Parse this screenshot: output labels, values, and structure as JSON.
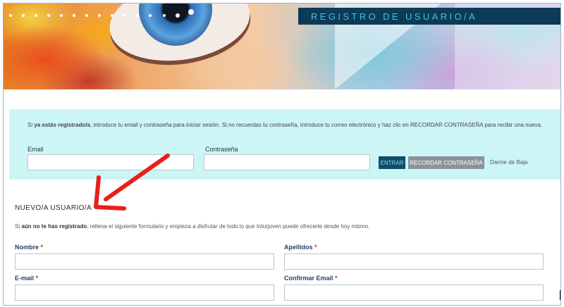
{
  "hero": {
    "title": "REGISTRO DE USUARIO/A",
    "dots_count": 12
  },
  "login": {
    "intro_pre": "Si ",
    "intro_bold": "ya estás registrado/a",
    "intro_post": ", introduce tu email y contraseña para iniciar sesión. Si no recuerdas tu contraseña, introduce tu correo electrónico y haz clic en RECORDAR CONTRASEÑA para recibir una nueva.",
    "email_label": "Email",
    "email_value": "",
    "password_label": "Contraseña",
    "password_value": "",
    "enter_button": "ENTRAR",
    "remember_button": "RECORDAR CONTRASEÑA",
    "unsubscribe_link": "Darme de Baja"
  },
  "register": {
    "title": "NUEVO/A USUARIO/A",
    "intro_pre": "Si ",
    "intro_bold": "aún no te has registrado",
    "intro_post": ", rellena el siguiente formulario y empieza a disfrutar de todo lo que Inturjoven puede ofrecerte desde hoy mismo.",
    "required_mark": "*",
    "fields": {
      "nombre": {
        "label": "Nombre",
        "value": ""
      },
      "apellidos": {
        "label": "Apellidos",
        "value": ""
      },
      "email": {
        "label": "E-mail",
        "value": ""
      },
      "confirm_email": {
        "label": "Confirmar Email",
        "value": ""
      }
    }
  },
  "colors": {
    "title_bar": "#0d3a57",
    "title_text": "#3cc7d6",
    "login_bg": "#ccf5f6",
    "enter_button": "#124c6b",
    "remember_button": "#8a949a",
    "arrow": "#e8201a",
    "required": "#c0392b"
  }
}
